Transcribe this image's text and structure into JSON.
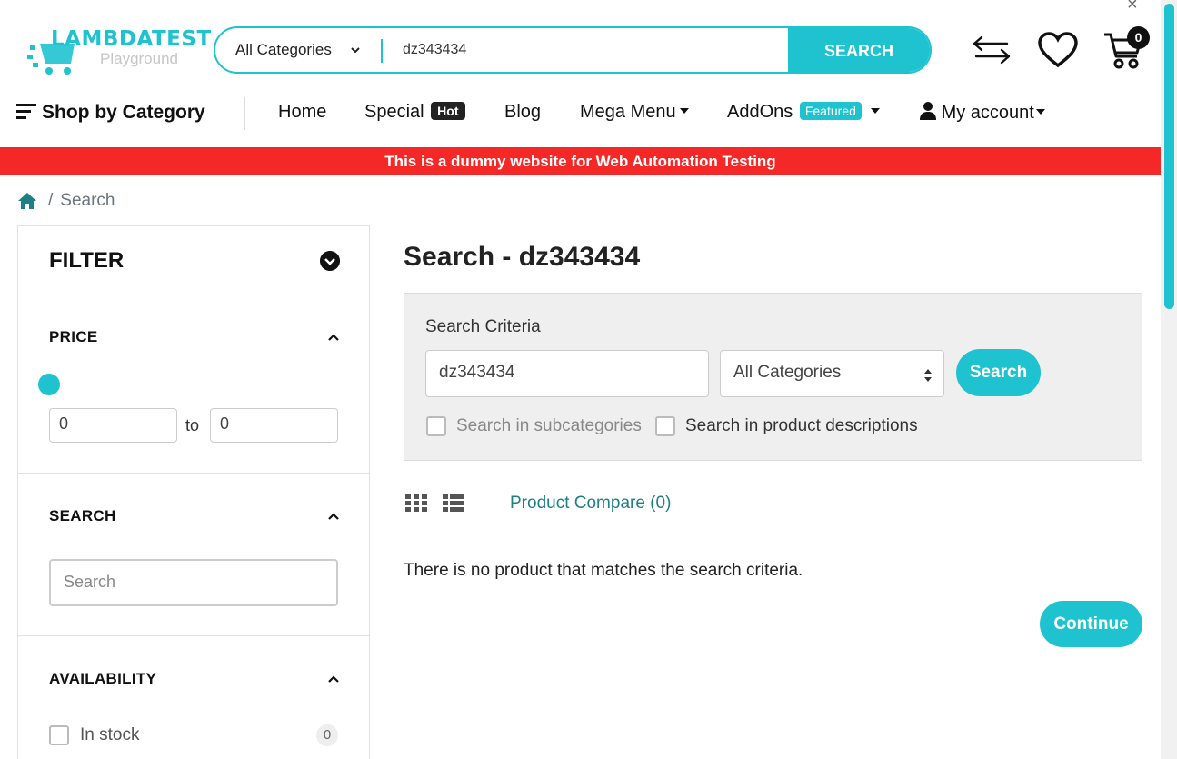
{
  "header": {
    "logo_brand": "LAMBDATEST",
    "logo_sub": "Playground",
    "search": {
      "category": "All Categories",
      "query": "dz343434",
      "button": "SEARCH"
    },
    "icons": [
      "compare-arrows-icon",
      "heart-icon",
      "cart-icon"
    ],
    "cart_count": "0"
  },
  "nav": {
    "shop_by_category": "Shop by Category",
    "home": "Home",
    "special": "Special",
    "special_badge": "Hot",
    "blog": "Blog",
    "mega_menu": "Mega Menu",
    "addons": "AddOns",
    "addons_badge": "Featured",
    "my_account": "My account"
  },
  "banner": "This is a dummy website for Web Automation Testing",
  "breadcrumb": {
    "separator": "/",
    "current": "Search"
  },
  "sidebar": {
    "filter_title": "FILTER",
    "price": {
      "title": "PRICE",
      "min": "0",
      "max": "0",
      "to_label": "to"
    },
    "search": {
      "title": "SEARCH",
      "placeholder": "Search"
    },
    "availability": {
      "title": "AVAILABILITY",
      "in_stock_label": "In stock",
      "in_stock_count": "0"
    }
  },
  "main": {
    "title": "Search - dz343434",
    "criteria": {
      "label": "Search Criteria",
      "keyword": "dz343434",
      "category": "All Categories",
      "button": "Search",
      "subcategories_label": "Search in subcategories",
      "descriptions_label": "Search in product descriptions"
    },
    "compare_link": "Product Compare (0)",
    "no_results": "There is no product that matches the search criteria.",
    "continue_button": "Continue"
  },
  "colors": {
    "accent": "#1ec3cf",
    "banner": "#f42827",
    "link": "#1f7f86"
  }
}
